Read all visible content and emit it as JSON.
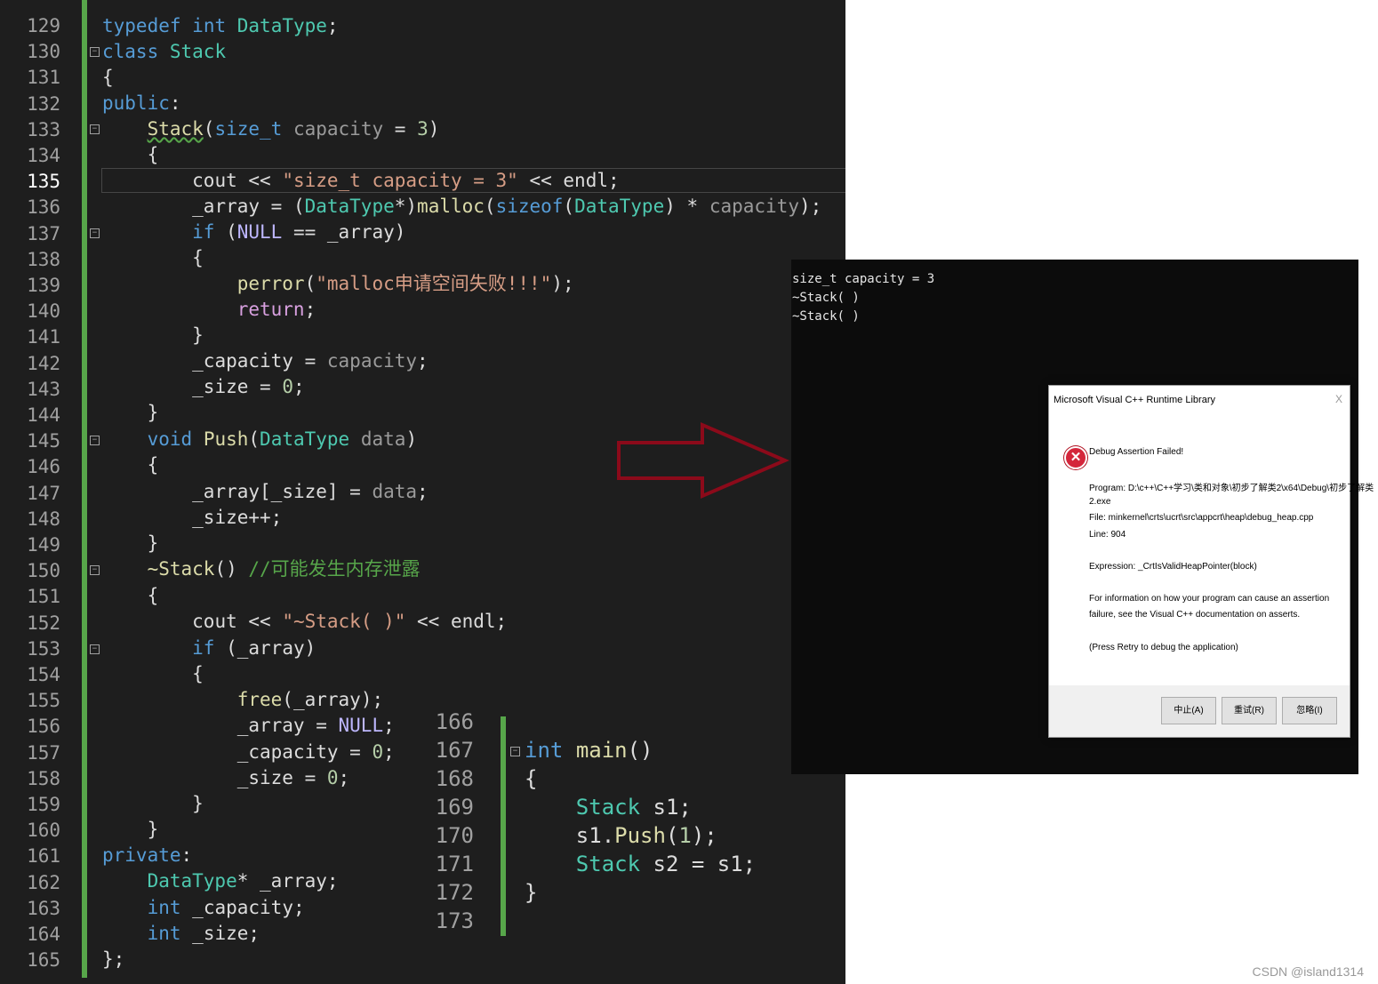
{
  "editor": {
    "line_numbers": [
      "129",
      "130",
      "131",
      "132",
      "133",
      "134",
      "135",
      "136",
      "137",
      "138",
      "139",
      "140",
      "141",
      "142",
      "143",
      "144",
      "145",
      "146",
      "147",
      "148",
      "149",
      "150",
      "151",
      "152",
      "153",
      "154",
      "155",
      "156",
      "157",
      "158",
      "159",
      "160",
      "161",
      "162",
      "163",
      "164",
      "165"
    ],
    "active_line": "135"
  },
  "code_tokens": {
    "typedef": "typedef",
    "int": "int",
    "datatype": "DataType",
    "class": "class",
    "stack": "Stack",
    "public": "public",
    "size_t": "size_t",
    "capacity": "capacity",
    "three": "3",
    "cout": "cout",
    "str1": "\"size_t capacity = 3\"",
    "endl": "endl",
    "array": "_array",
    "malloc": "malloc",
    "sizeof": "sizeof",
    "if": "if",
    "null": "NULL",
    "perror": "perror",
    "str2": "\"malloc申请空间失败!!!\"",
    "return": "return",
    "mcapacity": "_capacity",
    "msize": "_size",
    "zero": "0",
    "void": "void",
    "push": "Push",
    "data": "data",
    "dtor": "~Stack",
    "comment": "//可能发生内存泄露",
    "str3": "\"~Stack( )\"",
    "free": "free",
    "private": "private"
  },
  "editor2": {
    "line_numbers": [
      "166",
      "167",
      "168",
      "169",
      "170",
      "171",
      "172",
      "173"
    ],
    "main": "main",
    "s1": "s1",
    "s2": "s2",
    "one": "1"
  },
  "console": {
    "lines": [
      "size_t capacity = 3",
      "~Stack( )",
      "~Stack( )"
    ]
  },
  "dialog": {
    "title": "Microsoft Visual C++ Runtime Library",
    "close": "X",
    "heading": "Debug Assertion Failed!",
    "program1": "Program: D:\\c++\\C++学习\\类和对象\\初步了解类2\\x64\\Debug\\初步了解类",
    "program2": "2.exe",
    "file": "File: minkernel\\crts\\ucrt\\src\\appcrt\\heap\\debug_heap.cpp",
    "line": "Line: 904",
    "expression": "Expression: _CrtIsValidHeapPointer(block)",
    "info1": "For information on how your program can cause an assertion",
    "info2": "failure, see the Visual C++ documentation on asserts.",
    "press": "(Press Retry to debug the application)",
    "buttons": [
      "中止(A)",
      "重试(R)",
      "忽略(I)"
    ]
  },
  "watermark": "CSDN @island1314",
  "colors": {
    "editor_bg": "#1e1e1e",
    "keyword": "#569cd6",
    "type": "#4ec9b0",
    "arrow": "#8b0a1a"
  }
}
